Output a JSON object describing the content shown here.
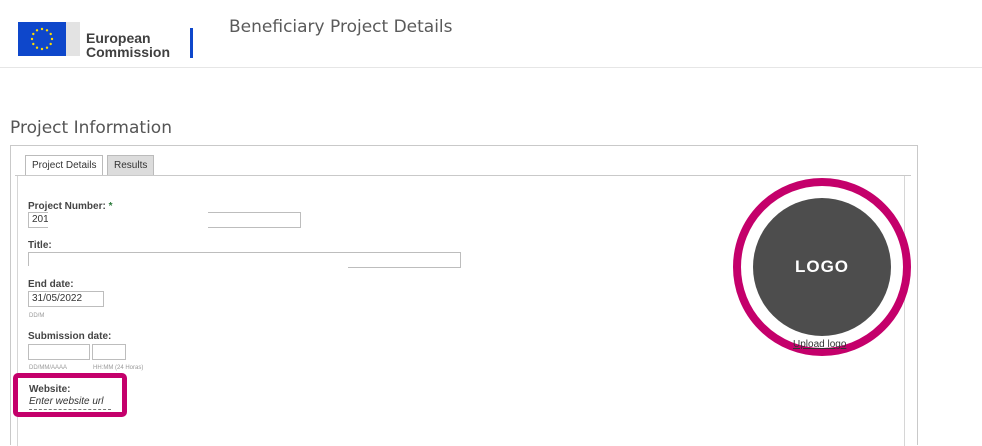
{
  "header": {
    "org_line1": "European",
    "org_line2": "Commission",
    "app_title": "Beneficiary Project Details",
    "flag_icon": "eu-flag-icon",
    "colors": {
      "flag": "#0e47cb",
      "accent": "#c4006b"
    }
  },
  "section": {
    "title": "Project Information"
  },
  "tabs": [
    {
      "label": "Project Details",
      "active": true
    },
    {
      "label": "Results",
      "active": false
    }
  ],
  "form": {
    "project_number": {
      "label": "Project Number:",
      "required_mark": "*",
      "value": "201"
    },
    "title": {
      "label": "Title:",
      "value": ""
    },
    "end_date": {
      "label": "End date:",
      "value": "31/05/2022",
      "hint": "DD/M"
    },
    "submission_date": {
      "label": "Submission date:",
      "date_hint": "DD/MM/AAAA",
      "time_hint": "HH:MM (24 Horas)"
    },
    "website": {
      "label": "Website:",
      "placeholder": "Enter website url"
    }
  },
  "logo": {
    "text": "LOGO",
    "upload_link": "Upload logo"
  }
}
